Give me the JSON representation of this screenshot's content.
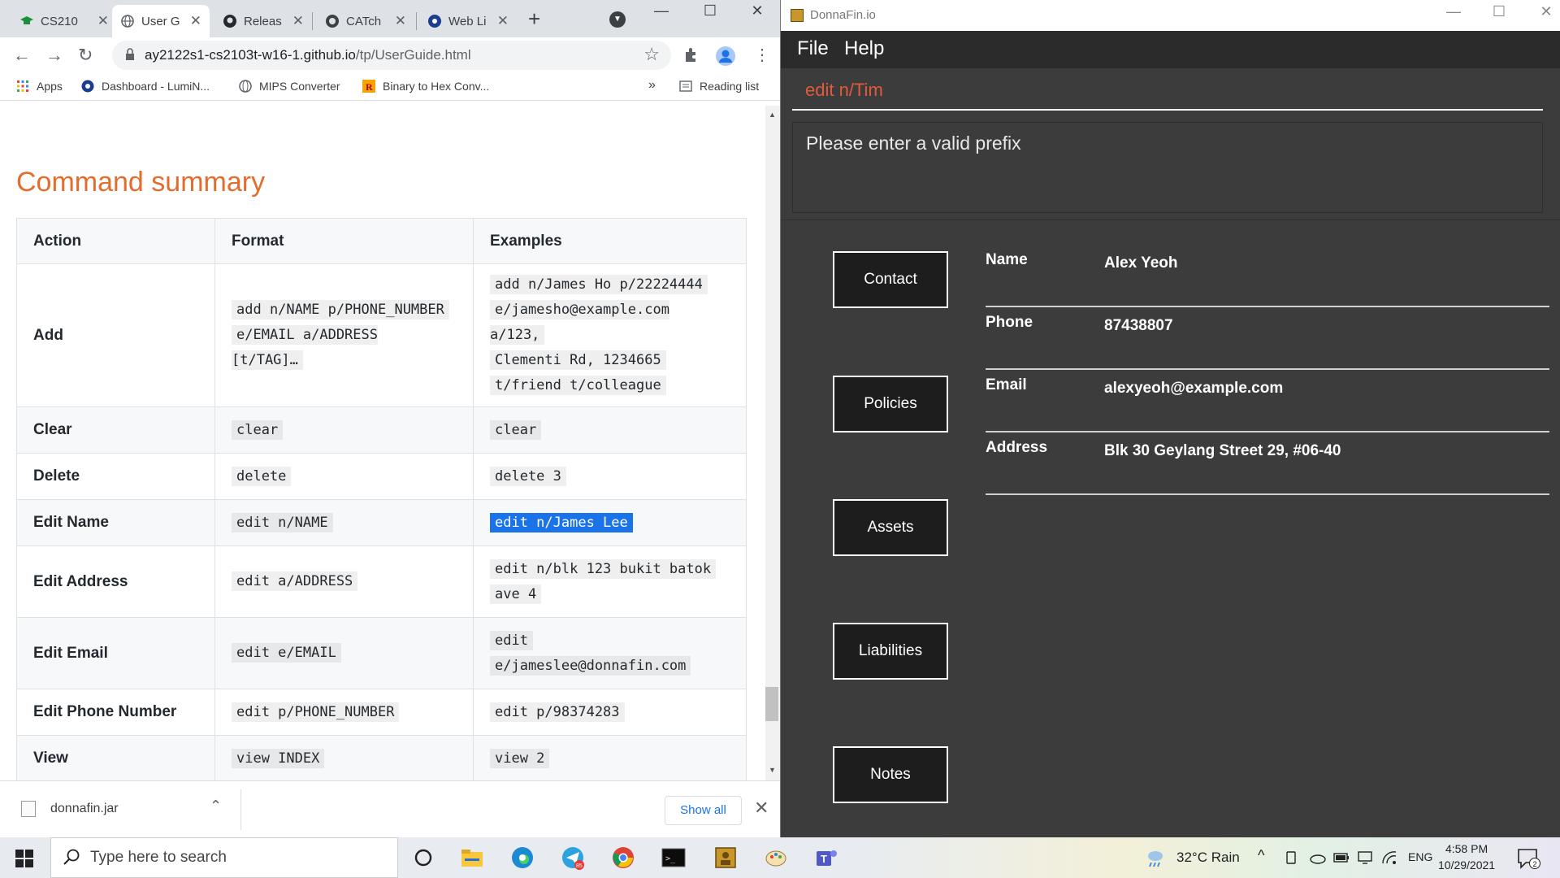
{
  "browser": {
    "tabs": [
      {
        "label": "CS210"
      },
      {
        "label": "User G"
      },
      {
        "label": "Releas"
      },
      {
        "label": "CATch"
      },
      {
        "label": "Web Li"
      }
    ],
    "url_host": "ay2122s1-cs2103t-w16-1.github.io",
    "url_path": "/tp/UserGuide.html",
    "bookmarks": [
      {
        "label": "Apps"
      },
      {
        "label": "Dashboard - LumiN..."
      },
      {
        "label": "MIPS Converter"
      },
      {
        "label": "Binary to Hex Conv..."
      }
    ],
    "bookmarks_more": "»",
    "reading_list": "Reading list"
  },
  "page": {
    "section_title": "Command summary",
    "table": {
      "headers": [
        "Action",
        "Format",
        "Examples"
      ],
      "rows": [
        {
          "action": "Add",
          "format": [
            "add n/NAME p/PHONE_NUMBER",
            "e/EMAIL a/ADDRESS [t/TAG]…"
          ],
          "examples": [
            "add n/James Ho p/22224444",
            "e/jamesho@example.com a/123,",
            "Clementi Rd, 1234665",
            "t/friend t/colleague"
          ]
        },
        {
          "action": "Clear",
          "format": [
            "clear"
          ],
          "examples": [
            "clear"
          ]
        },
        {
          "action": "Delete",
          "format": [
            "delete"
          ],
          "examples": [
            "delete 3"
          ]
        },
        {
          "action": "Edit Name",
          "format": [
            "edit n/NAME"
          ],
          "examples": [
            "edit n/James Lee"
          ],
          "selected": true
        },
        {
          "action": "Edit Address",
          "format": [
            "edit a/ADDRESS"
          ],
          "examples": [
            "edit n/blk 123 bukit batok",
            "ave 4"
          ]
        },
        {
          "action": "Edit Email",
          "format": [
            "edit e/EMAIL"
          ],
          "examples": [
            "edit",
            "e/jameslee@donnafin.com"
          ]
        },
        {
          "action": "Edit Phone Number",
          "format": [
            "edit p/PHONE_NUMBER"
          ],
          "examples": [
            "edit p/98374283"
          ]
        },
        {
          "action": "View",
          "format": [
            "view INDEX"
          ],
          "examples": [
            "view 2"
          ]
        }
      ]
    }
  },
  "downloads": {
    "file": "donnafin.jar",
    "show_all": "Show all"
  },
  "donnafin": {
    "window_title": "DonnaFin.io",
    "menu": [
      "File",
      "Help"
    ],
    "command_input": "edit n/Tim",
    "result_message": "Please enter a valid prefix",
    "tabs": [
      "Contact",
      "Policies",
      "Assets",
      "Liabilities",
      "Notes"
    ],
    "fields": [
      {
        "label": "Name",
        "value": "Alex Yeoh"
      },
      {
        "label": "Phone",
        "value": "87438807"
      },
      {
        "label": "Email",
        "value": "alexyeoh@example.com"
      },
      {
        "label": "Address",
        "value": "Blk 30 Geylang Street 29, #06-40"
      }
    ]
  },
  "taskbar": {
    "search_placeholder": "Type here to search",
    "weather": "32°C  Rain",
    "language": "ENG",
    "time": "4:58 PM",
    "date": "10/29/2021",
    "notification_count": "2",
    "telegram_badge": "85"
  }
}
